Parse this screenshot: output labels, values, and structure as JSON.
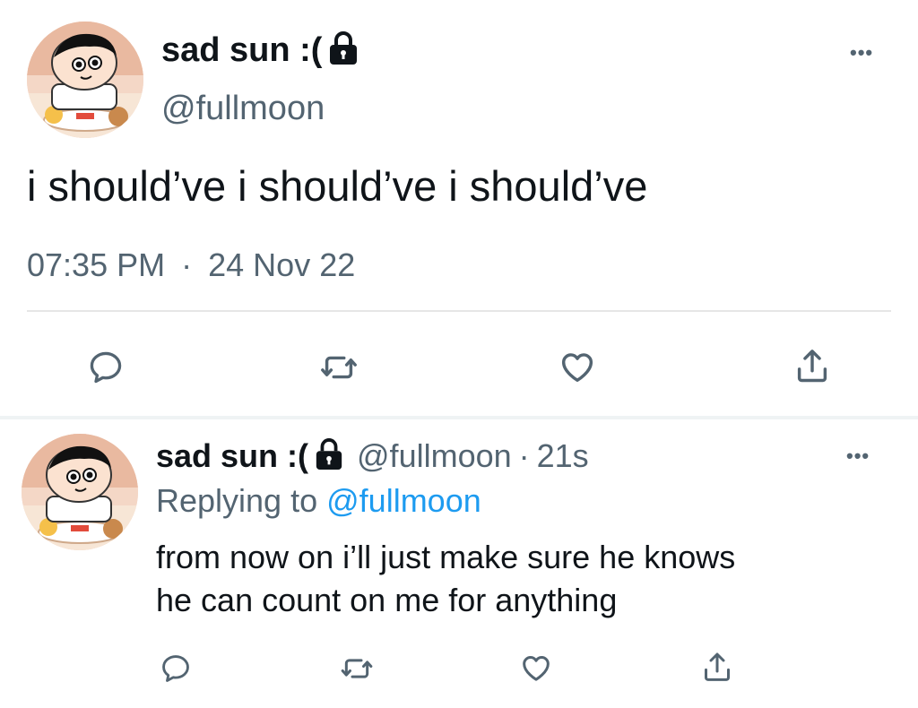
{
  "main_tweet": {
    "display_name": "sad sun :(",
    "handle": "@fullmoon",
    "text": "i should’ve i should’ve i should’ve",
    "time": "07:35 PM",
    "separator": "·",
    "date": "24 Nov 22",
    "more": "•••",
    "actions": [
      "reply-icon",
      "retweet-icon",
      "like-icon",
      "share-icon"
    ]
  },
  "reply_tweet": {
    "display_name": "sad sun :(",
    "handle": "@fullmoon",
    "separator": "·",
    "age": "21s",
    "replying_prefix": "Replying to",
    "replying_handle": "@fullmoon",
    "text_line1": "from now on i’ll just make sure he knows",
    "text_line2": "he can count on me for anything",
    "more": "•••",
    "actions": [
      "reply-icon",
      "retweet-icon",
      "like-icon",
      "share-icon"
    ]
  },
  "colors": {
    "text": "#0f1419",
    "muted": "#536471",
    "link": "#1d9bf0",
    "divider": "#e6e6e6"
  }
}
